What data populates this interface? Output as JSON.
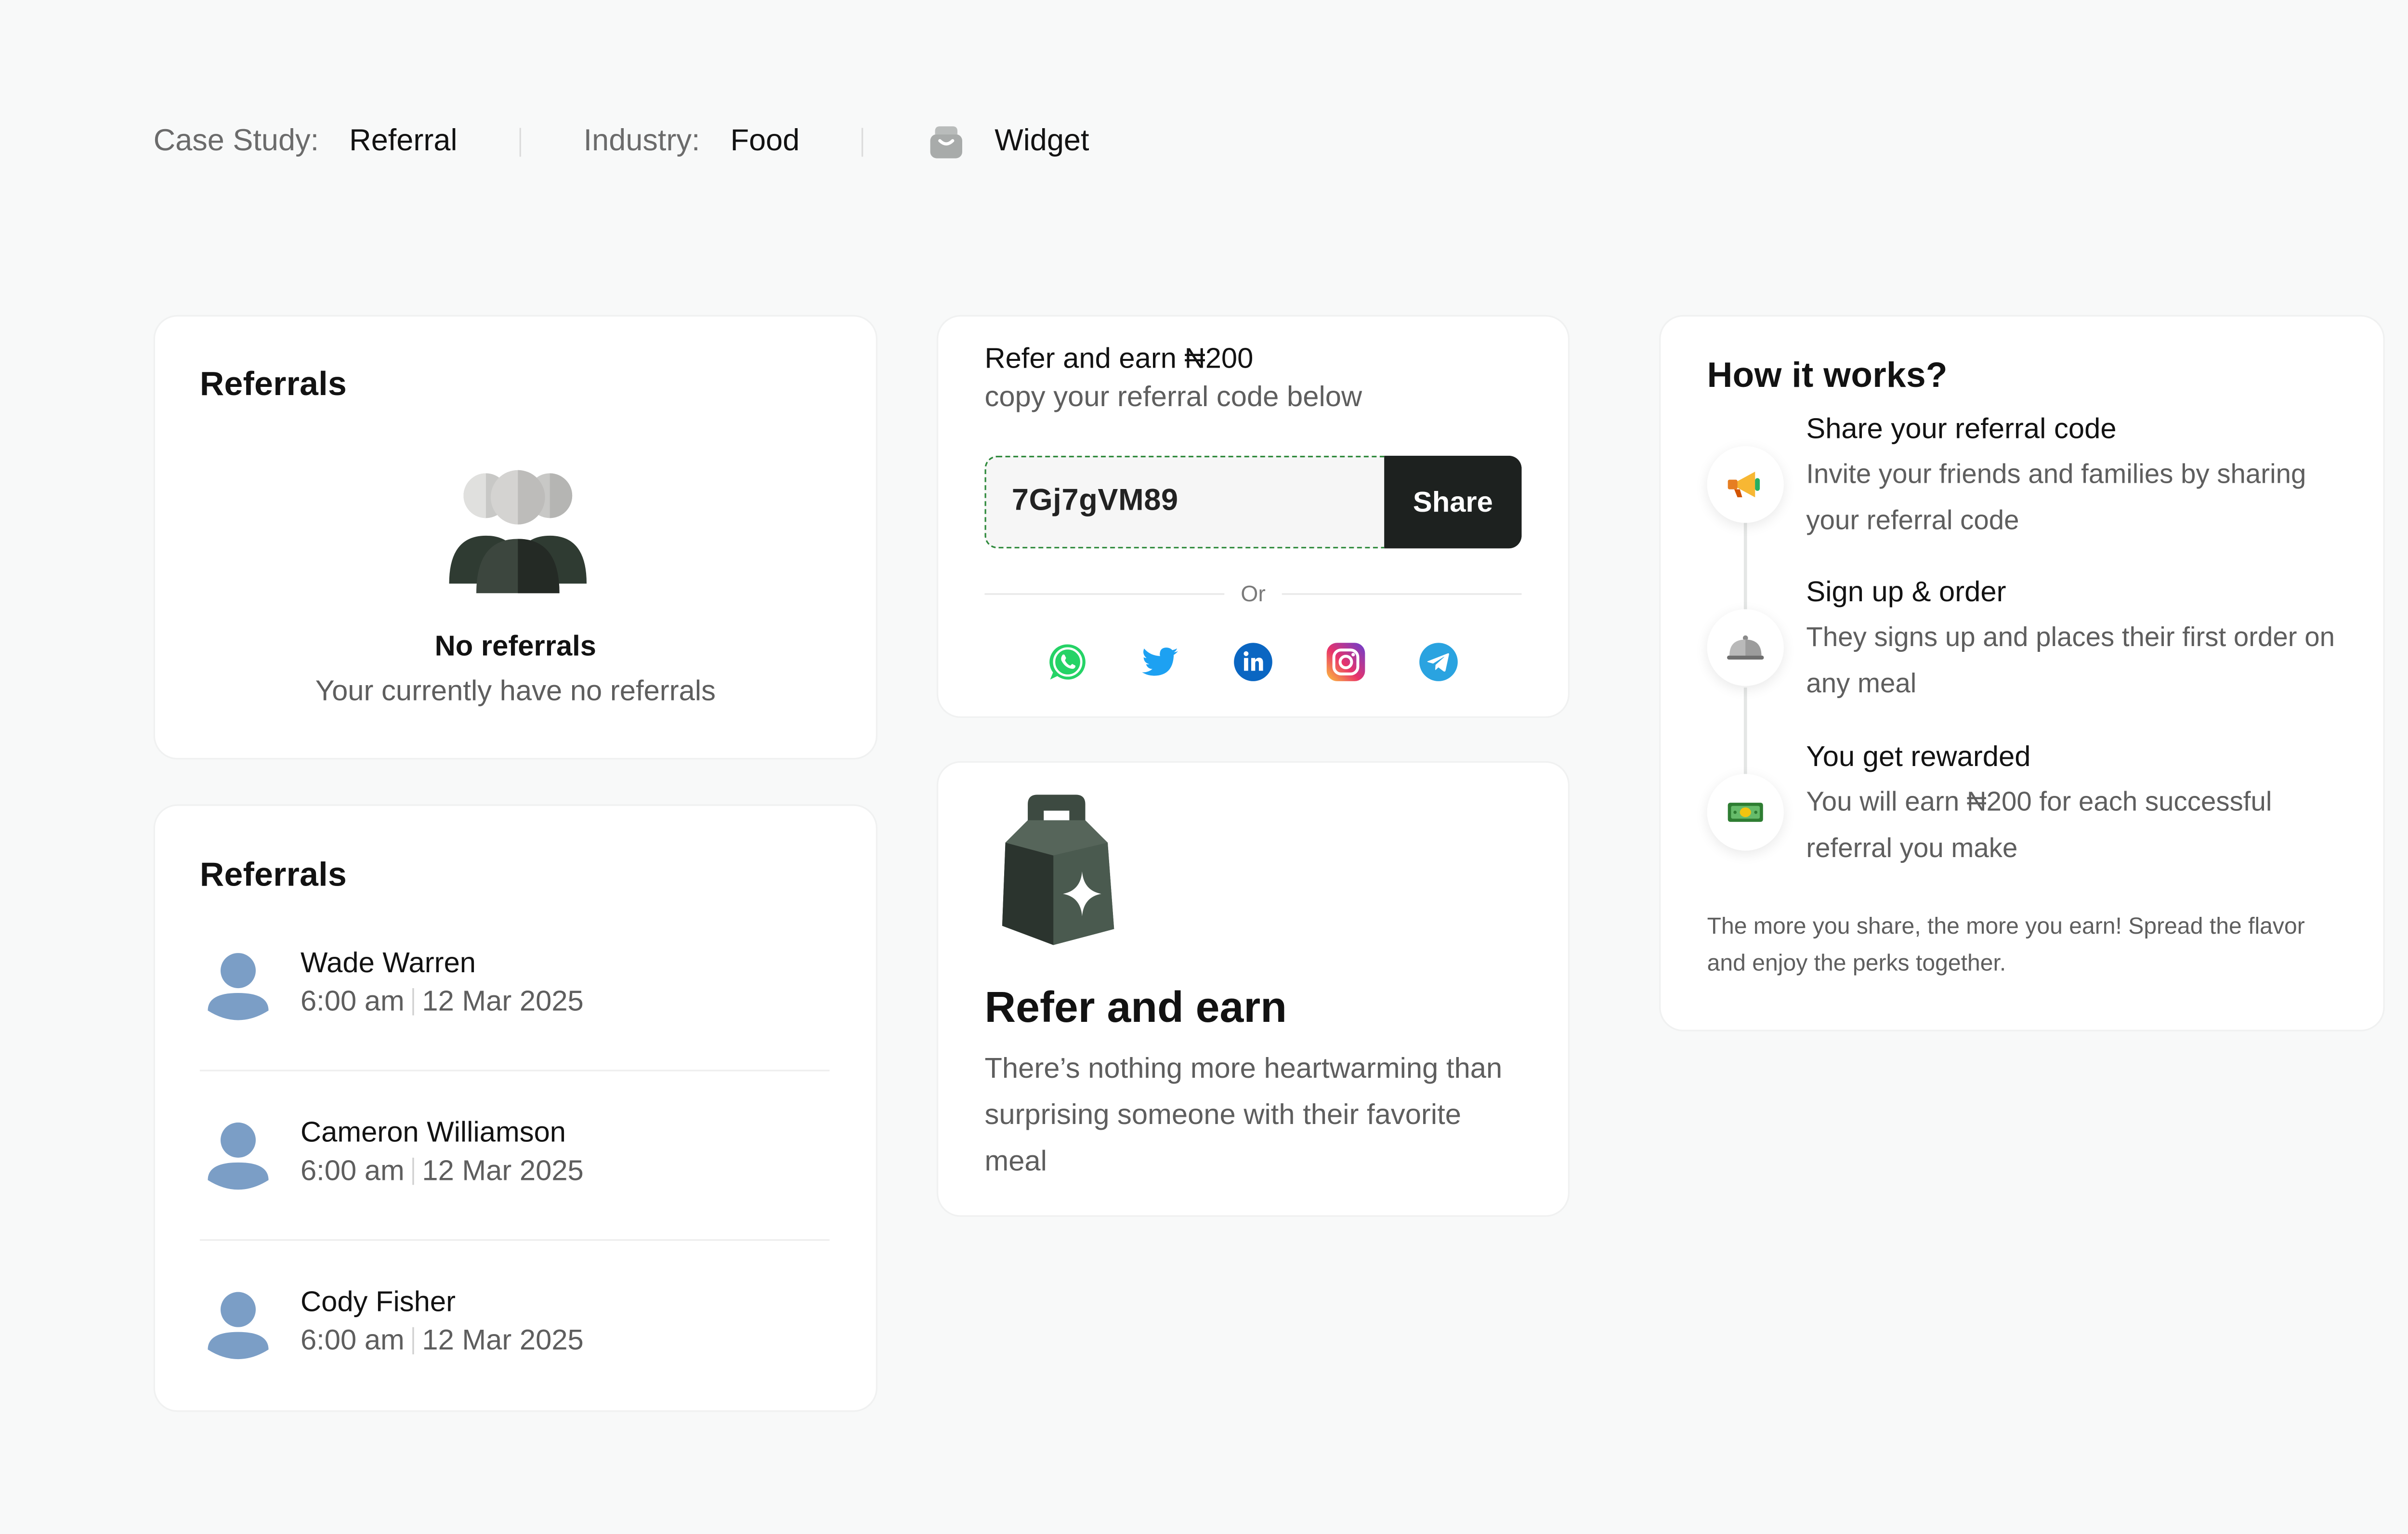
{
  "meta": {
    "case_label": "Case Study:",
    "case_value": "Referral",
    "industry_label": "Industry:",
    "industry_value": "Food",
    "widget_label": "Widget",
    "widget_icon": "archive-box-icon"
  },
  "empty_card": {
    "title": "Referrals",
    "heading": "No referrals",
    "subtext": "Your currently have no referrals",
    "illustration": "people-group-icon"
  },
  "list_card": {
    "title": "Referrals",
    "items": [
      {
        "name": "Wade Warren",
        "time": "6:00 am",
        "date": "12 Mar 2025"
      },
      {
        "name": "Cameron Williamson",
        "time": "6:00 am",
        "date": "12 Mar 2025"
      },
      {
        "name": "Cody Fisher",
        "time": "6:00 am",
        "date": "12 Mar 2025"
      }
    ]
  },
  "code_card": {
    "title": "Refer and earn ₦200",
    "subtitle": "copy your referral code below",
    "code": "7Gj7gVM89",
    "share_label": "Share",
    "or_label": "Or",
    "socials": [
      "whatsapp-icon",
      "twitter-icon",
      "linkedin-icon",
      "instagram-icon",
      "telegram-icon"
    ]
  },
  "promo_card": {
    "title": "Refer and earn",
    "text": "There’s nothing more heartwarming than surprising someone with their favorite meal",
    "illustration": "food-bag-icon"
  },
  "how_card": {
    "title": "How it works?",
    "steps": [
      {
        "title": "Share your referral code",
        "desc": "Invite your friends and families by sharing your referral code",
        "icon": "megaphone-icon"
      },
      {
        "title": "Sign up & order",
        "desc": "They signs up and places their first order on any meal",
        "icon": "food-cloche-icon"
      },
      {
        "title": "You get rewarded",
        "desc": "You will earn ₦200 for each successful referral you make",
        "icon": "cash-icon"
      }
    ],
    "footer": "The more you share, the more you earn! Spread the flavor and enjoy the perks together."
  },
  "colors": {
    "background": "#f8f9f9",
    "primary_dark": "#1d211f",
    "dashed_border": "#2f8a3c",
    "avatar_blue": "#7b9ec6",
    "muted_text": "#5e5e5e"
  }
}
